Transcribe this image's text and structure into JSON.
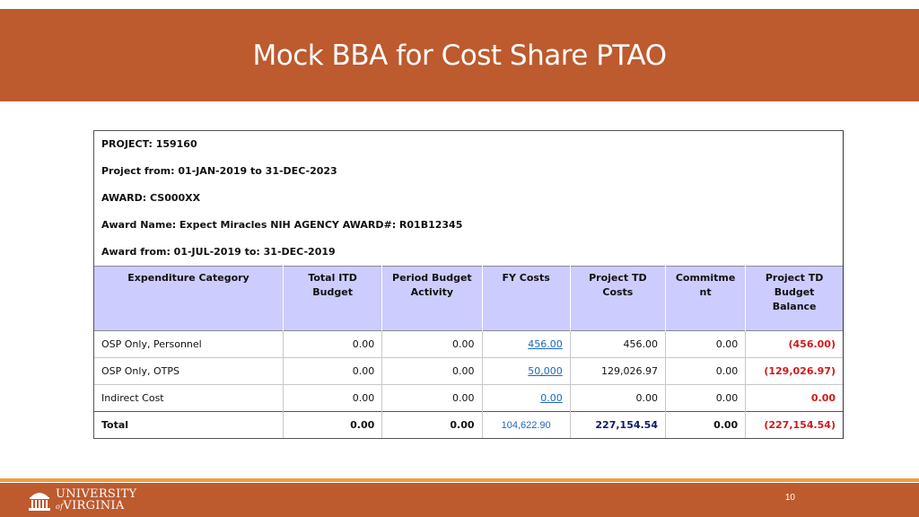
{
  "slide": {
    "title": "Mock BBA for Cost Share PTAO",
    "page_number": "10"
  },
  "report_header": {
    "project": "PROJECT: 159160",
    "project_dates": "Project from: 01-JAN-2019 to 31-DEC-2023",
    "award": "AWARD: CS000XX",
    "award_name": "Award Name: Expect Miracles NIH AGENCY AWARD#: R01B12345",
    "award_dates": "Award from: 01-JUL-2019 to: 31-DEC-2019"
  },
  "table": {
    "columns": [
      "Expenditure Category",
      "Total ITD Budget",
      "Period Budget Activity",
      "FY Costs",
      "Project TD Costs",
      "Commitment",
      "Project TD Budget Balance"
    ],
    "rows": [
      [
        "OSP Only, Personnel",
        "0.00",
        "0.00",
        "456.00 ",
        "456.00",
        "0.00",
        "(456.00)"
      ],
      [
        "OSP Only, OTPS",
        "0.00",
        "0.00",
        "50,000 ",
        "129,026.97",
        "0.00",
        "(129,026.97)"
      ],
      [
        "Indirect Cost",
        "0.00",
        "0.00",
        "0.00 ",
        "0.00",
        "0.00",
        "0.00"
      ]
    ],
    "total": [
      "Total",
      "0.00",
      "0.00",
      "104,622.90",
      "227,154.54",
      "0.00",
      "(227,154.54)"
    ]
  },
  "footer": {
    "logo_line1": "UNIVERSITY",
    "logo_of": "of",
    "logo_line2": "VIRGINIA"
  },
  "colors": {
    "brand_orange": "#bd5a2e",
    "stripe": "#f29b3a",
    "header_fill": "#ccccff",
    "negative": "#d11a1a",
    "link": "#1a66c4"
  }
}
